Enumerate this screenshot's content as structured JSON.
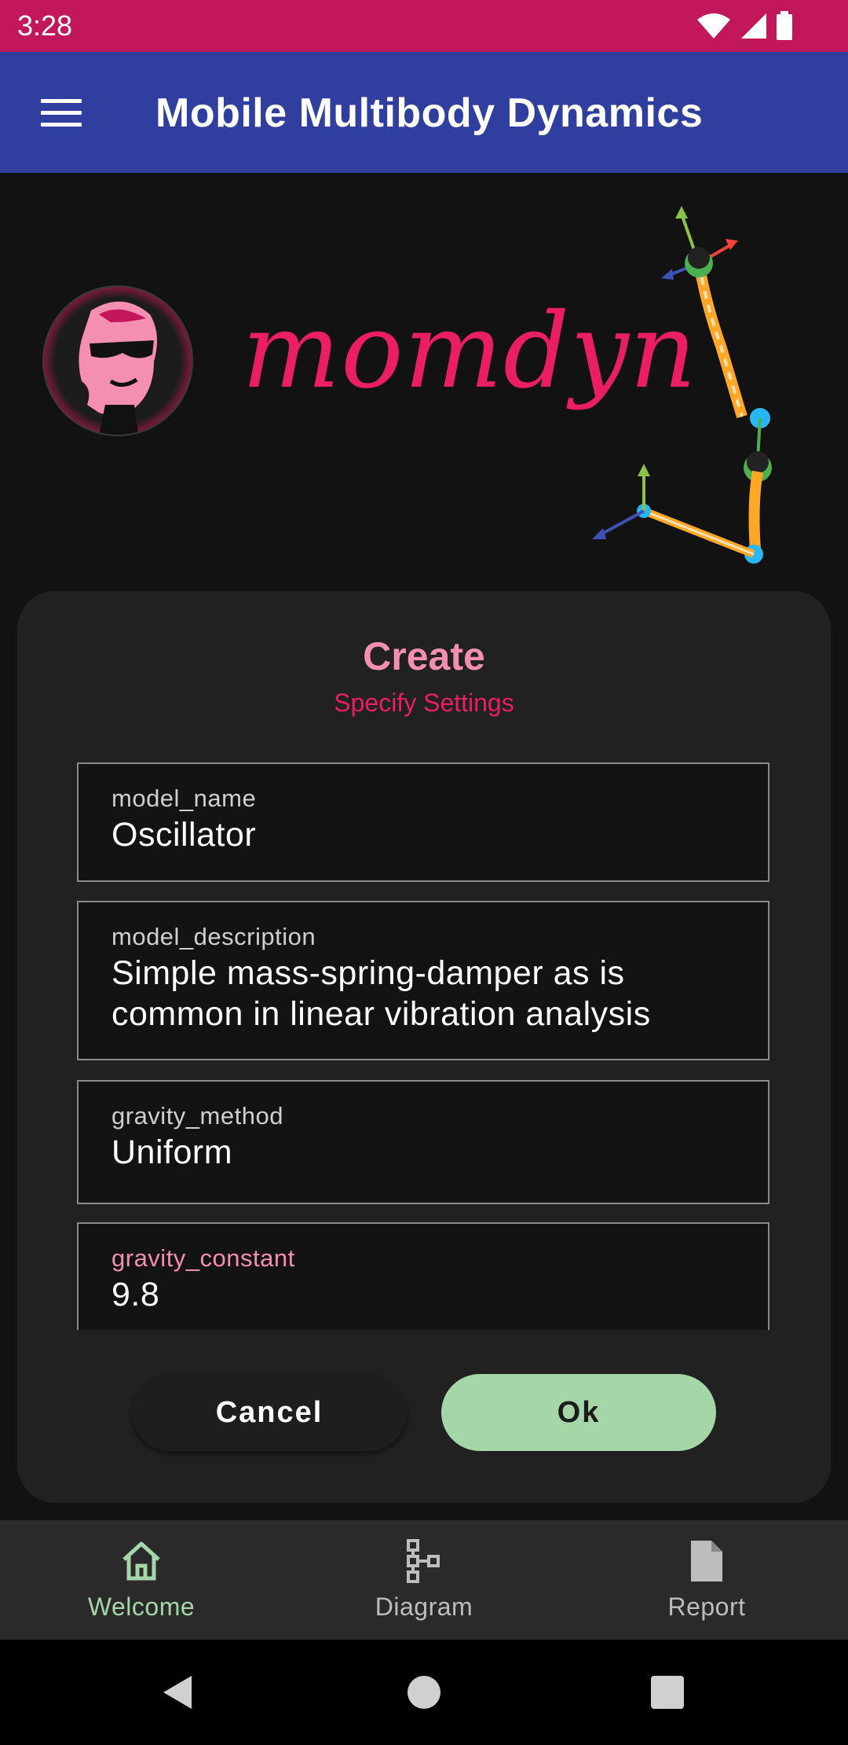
{
  "status_bar": {
    "time": "3:28"
  },
  "app_bar": {
    "title": "Mobile Multibody Dynamics",
    "menu_icon": "hamburger-menu-icon"
  },
  "hero": {
    "logo_text": "momdyn"
  },
  "dialog": {
    "title": "Create",
    "subtitle": "Specify Settings",
    "fields": [
      {
        "label": "model_name",
        "value": "Oscillator"
      },
      {
        "label": "model_description",
        "value": "Simple mass-spring-damper as is common in linear vibration analysis"
      },
      {
        "label": "gravity_method",
        "value": "Uniform"
      },
      {
        "label": "gravity_constant",
        "value": "9.8"
      }
    ],
    "cancel_label": "Cancel",
    "ok_label": "Ok"
  },
  "bottom_nav": {
    "items": [
      {
        "label": "Welcome",
        "icon": "home-icon",
        "active": true
      },
      {
        "label": "Diagram",
        "icon": "diagram-icon",
        "active": false
      },
      {
        "label": "Report",
        "icon": "document-icon",
        "active": false
      }
    ]
  },
  "colors": {
    "status_bar": "#C2185B",
    "app_bar": "#303F9F",
    "accent_pink": "#E91E63",
    "title_pink": "#F48FB1",
    "ok_green": "#A5D6A7",
    "dialog_bg": "#212121",
    "page_bg": "#121212"
  }
}
